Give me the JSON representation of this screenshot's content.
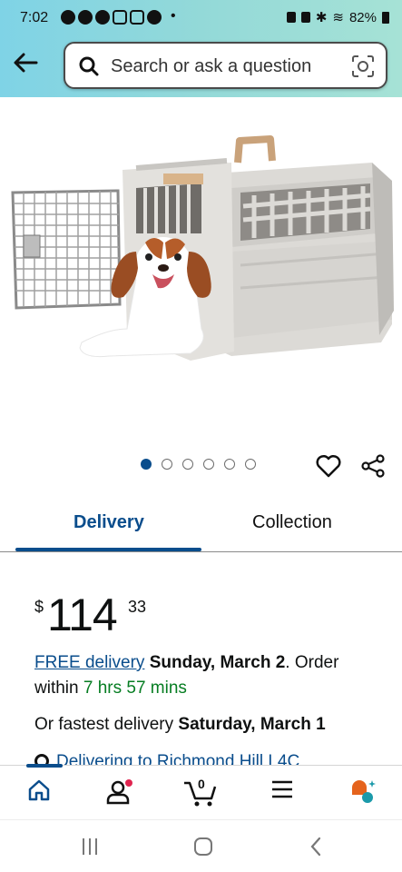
{
  "status_bar": {
    "time": "7:02",
    "battery": "82%"
  },
  "search": {
    "placeholder": "Search or ask a question"
  },
  "carousel": {
    "total": 6,
    "active_index": 0
  },
  "tabs": [
    {
      "label": "Delivery",
      "active": true
    },
    {
      "label": "Collection",
      "active": false
    }
  ],
  "price": {
    "currency": "$",
    "whole": "114",
    "fraction": "33"
  },
  "delivery": {
    "free_label": "FREE delivery",
    "date": "Sunday, March 2",
    "order_text": ". Order within",
    "countdown": "7 hrs 57 mins",
    "fastest_prefix": "Or fastest delivery",
    "fastest_date": "Saturday, March 1",
    "location": "Delivering to Richmond Hill L4C"
  },
  "bottom_nav": {
    "cart_count": "0"
  },
  "colors": {
    "accent": "#0a4d8c",
    "green": "#067d22",
    "header_from": "#7fd3e6",
    "header_to": "#a6e2d6",
    "badge": "#e0244f"
  },
  "icons": [
    "back-arrow-icon",
    "search-icon",
    "camera-lens-icon",
    "heart-icon",
    "share-icon",
    "home-icon",
    "account-icon",
    "cart-icon",
    "menu-icon",
    "rufus-icon",
    "recents-icon",
    "home-circle-icon",
    "back-chevron-icon"
  ]
}
